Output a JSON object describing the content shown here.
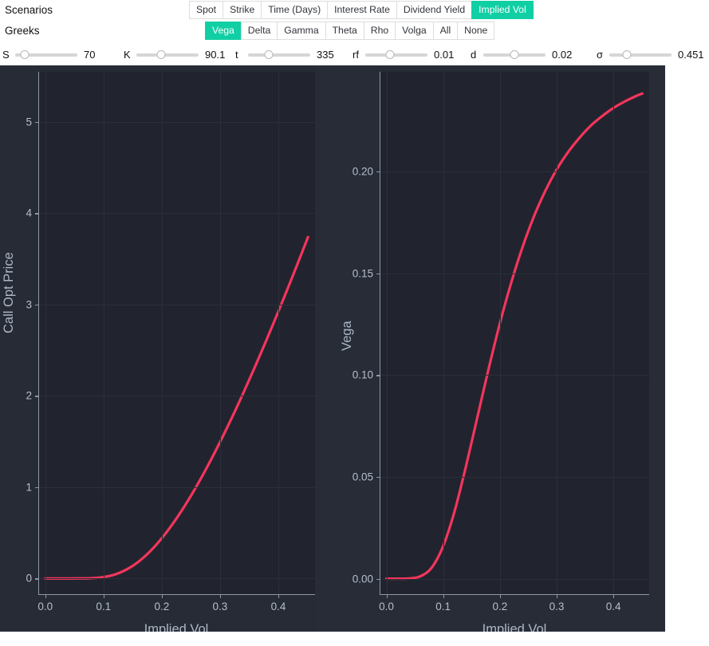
{
  "controls": {
    "scenarios_label": "Scenarios",
    "greeks_label": "Greeks",
    "accent_color": "#11cfa4",
    "scenarios": [
      {
        "label": "Spot",
        "active": false
      },
      {
        "label": "Strike",
        "active": false
      },
      {
        "label": "Time (Days)",
        "active": false
      },
      {
        "label": "Interest Rate",
        "active": false
      },
      {
        "label": "Dividend Yield",
        "active": false
      },
      {
        "label": "Implied Vol",
        "active": true
      }
    ],
    "greeks": [
      {
        "label": "Vega",
        "active": true
      },
      {
        "label": "Delta",
        "active": false
      },
      {
        "label": "Gamma",
        "active": false
      },
      {
        "label": "Theta",
        "active": false
      },
      {
        "label": "Rho",
        "active": false
      },
      {
        "label": "Volga",
        "active": false
      },
      {
        "label": "All",
        "active": false
      },
      {
        "label": "None",
        "active": false
      }
    ],
    "sliders": [
      {
        "name": "spot",
        "label": "S",
        "value": "70",
        "pct": 16
      },
      {
        "name": "strike",
        "label": "K",
        "value": "90.1",
        "pct": 40
      },
      {
        "name": "time-days",
        "label": "t",
        "value": "335",
        "pct": 33
      },
      {
        "name": "interest-rate",
        "label": "rf",
        "value": "0.01",
        "pct": 40
      },
      {
        "name": "dividend",
        "label": "d",
        "value": "0.02",
        "pct": 50
      },
      {
        "name": "implied-vol",
        "label": "σ",
        "value": "0.451",
        "pct": 28
      }
    ]
  },
  "chart_data": [
    {
      "type": "line",
      "name": "call-opt-price",
      "title": "",
      "xlabel": "Implied Vol",
      "ylabel": "Call Opt Price",
      "xlim": [
        -0.012,
        0.463
      ],
      "ylim": [
        -0.18,
        5.55
      ],
      "xticks": [
        0.0,
        0.1,
        0.2,
        0.3,
        0.4
      ],
      "xticklabels": [
        "0.0",
        "0.1",
        "0.2",
        "0.3",
        "0.4"
      ],
      "yticks": [
        0,
        1,
        2,
        3,
        4,
        5
      ],
      "yticklabels": [
        "0",
        "1",
        "2",
        "3",
        "4",
        "5"
      ],
      "grid": true,
      "line_color": "#f4355c",
      "background": "#21242e",
      "x": [
        0.0,
        0.02,
        0.04,
        0.06,
        0.08,
        0.1,
        0.12,
        0.14,
        0.16,
        0.18,
        0.2,
        0.22,
        0.24,
        0.26,
        0.28,
        0.3,
        0.32,
        0.34,
        0.36,
        0.38,
        0.4,
        0.42,
        0.44,
        0.451
      ],
      "y": [
        0.0,
        0.0,
        0.0,
        0.001,
        0.004,
        0.016,
        0.045,
        0.1,
        0.184,
        0.298,
        0.441,
        0.61,
        0.802,
        1.015,
        1.247,
        1.495,
        1.757,
        2.033,
        2.32,
        2.617,
        2.923,
        3.238,
        3.56,
        3.74
      ]
    },
    {
      "type": "line",
      "name": "vega",
      "title": "",
      "xlabel": "Implied Vol",
      "ylabel": "Vega",
      "xlim": [
        -0.012,
        0.463
      ],
      "ylim": [
        -0.008,
        0.249
      ],
      "xticks": [
        0.0,
        0.1,
        0.2,
        0.3,
        0.4
      ],
      "xticklabels": [
        "0.0",
        "0.1",
        "0.2",
        "0.3",
        "0.4"
      ],
      "yticks": [
        0.0,
        0.05,
        0.1,
        0.15,
        0.2
      ],
      "yticklabels": [
        "0.00",
        "0.05",
        "0.10",
        "0.15",
        "0.20"
      ],
      "grid": true,
      "line_color": "#f4355c",
      "background": "#21242e",
      "x": [
        0.0,
        0.02,
        0.04,
        0.06,
        0.08,
        0.1,
        0.12,
        0.14,
        0.16,
        0.18,
        0.2,
        0.22,
        0.24,
        0.26,
        0.28,
        0.3,
        0.32,
        0.34,
        0.36,
        0.38,
        0.4,
        0.42,
        0.44,
        0.451
      ],
      "y": [
        0.0,
        0.0,
        0.0001,
        0.0012,
        0.0055,
        0.016,
        0.033,
        0.055,
        0.079,
        0.103,
        0.1255,
        0.1455,
        0.163,
        0.178,
        0.1905,
        0.201,
        0.2095,
        0.2165,
        0.2225,
        0.2272,
        0.2312,
        0.2344,
        0.2371,
        0.2383
      ]
    }
  ]
}
